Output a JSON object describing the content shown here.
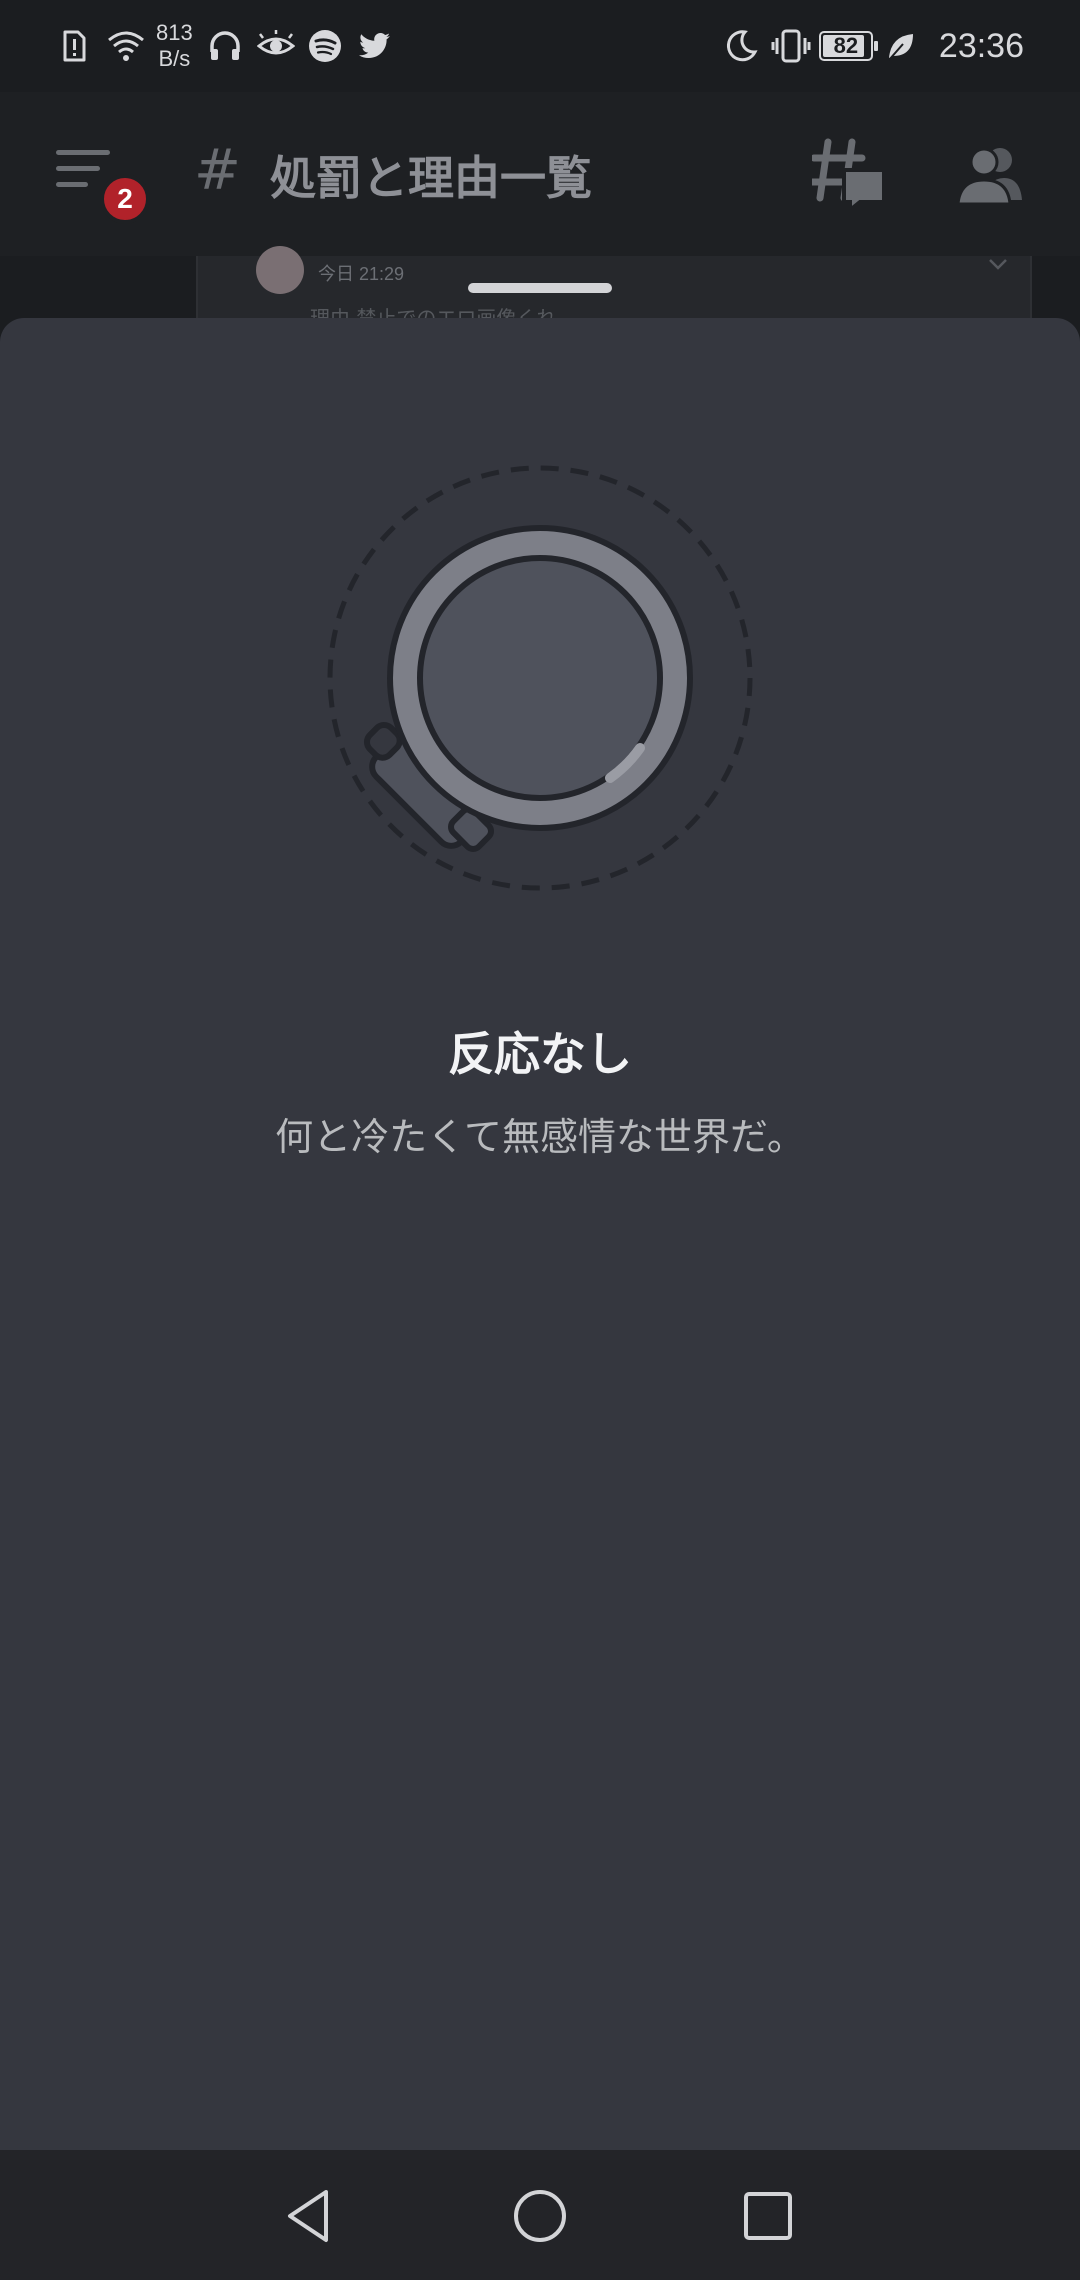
{
  "status_bar": {
    "net_speed_value": "813",
    "net_speed_unit": "B/s",
    "battery_level": "82",
    "time": "23:36"
  },
  "header": {
    "menu_badge_count": "2",
    "channel_hash": "#",
    "channel_name": "処罰と理由一覧"
  },
  "message_peek": {
    "timestamp": "今日 21:29",
    "snippet": "理由 禁止でのエロ画像くれ"
  },
  "empty_state": {
    "title": "反応なし",
    "subtitle": "何と冷たくて無感情な世界だ。"
  },
  "colors": {
    "sheet_bg": "#35373f",
    "header_bg": "#1e2023",
    "badge": "#b1222a",
    "title_text": "#f2f3f5",
    "subtitle_text": "#b9bbbe"
  },
  "icons": {
    "status_left": [
      "alert-card-icon",
      "wifi-icon",
      "headphones-icon",
      "eye-icon",
      "spotify-icon",
      "twitter-icon"
    ],
    "status_right": [
      "moon-icon",
      "vibrate-icon",
      "battery-icon",
      "leaf-icon"
    ],
    "header": [
      "menu-icon",
      "threads-icon",
      "members-icon"
    ],
    "nav": [
      "back-icon",
      "home-icon",
      "recents-icon"
    ]
  }
}
